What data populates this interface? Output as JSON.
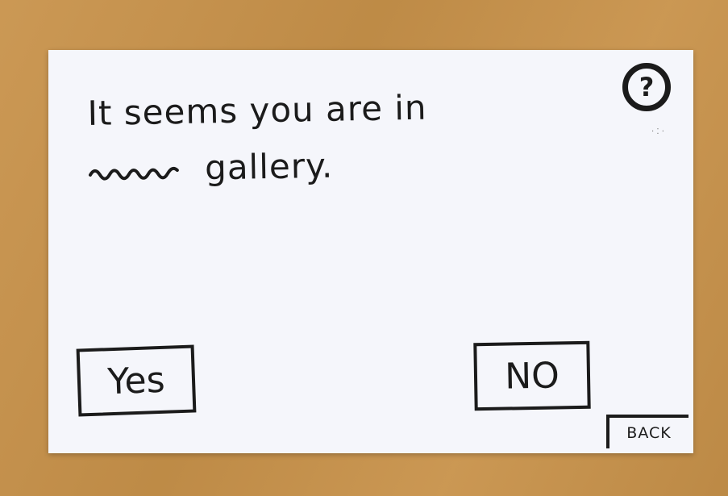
{
  "prompt": {
    "line1": "It seems you are in",
    "line2": "gallery."
  },
  "help_button": {
    "label": "?"
  },
  "buttons": {
    "yes_label": "Yes",
    "no_label": "NO",
    "back_label": "BACK"
  },
  "colors": {
    "ink": "#1b1b1b",
    "card": "#f5f6fb",
    "table": "#c8924a"
  }
}
